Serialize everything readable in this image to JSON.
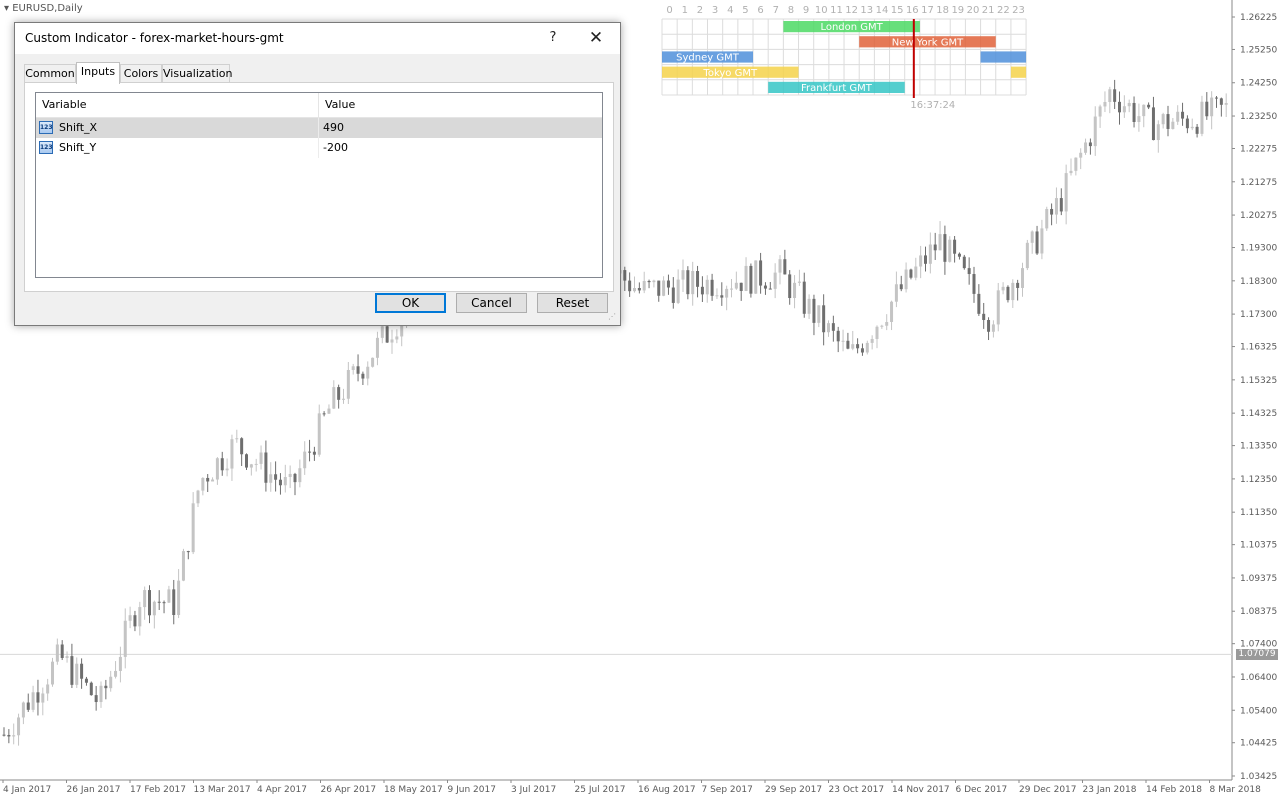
{
  "chart": {
    "symbol_title": "EURUSD,Daily",
    "current_price": "1.07079",
    "price_levels": [
      "1.26225",
      "1.25250",
      "1.24250",
      "1.23250",
      "1.22275",
      "1.21275",
      "1.20275",
      "1.19300",
      "1.18300",
      "1.17300",
      "1.16325",
      "1.15325",
      "1.14325",
      "1.13350",
      "1.12350",
      "1.11350",
      "1.10375",
      "1.09375",
      "1.08375",
      "1.07400",
      "1.06400",
      "1.05400",
      "1.04425",
      "1.03425"
    ],
    "date_labels": [
      "4 Jan 2017",
      "26 Jan 2017",
      "17 Feb 2017",
      "13 Mar 2017",
      "4 Apr 2017",
      "26 Apr 2017",
      "18 May 2017",
      "9 Jun 2017",
      "3 Jul 2017",
      "25 Jul 2017",
      "16 Aug 2017",
      "7 Sep 2017",
      "29 Sep 2017",
      "23 Oct 2017",
      "14 Nov 2017",
      "6 Dec 2017",
      "29 Dec 2017",
      "23 Jan 2018",
      "14 Feb 2018",
      "8 Mar 2018"
    ],
    "colors": {
      "bull": "#c4c4c4",
      "bear": "#6e6e6e",
      "text": "#5a5a5a",
      "grid_line": "#d8d8d8"
    }
  },
  "market_hours": {
    "hours": [
      "0",
      "1",
      "2",
      "3",
      "4",
      "5",
      "6",
      "7",
      "8",
      "9",
      "10",
      "11",
      "12",
      "13",
      "14",
      "15",
      "16",
      "17",
      "18",
      "19",
      "20",
      "21",
      "22",
      "23"
    ],
    "clock": "16:37:24",
    "sessions": [
      {
        "name": "London GMT",
        "start": 8,
        "end": 17,
        "extra_start": null,
        "extra_end": null,
        "color": "#4cd964"
      },
      {
        "name": "New York GMT",
        "start": 13,
        "end": 22,
        "extra_start": null,
        "extra_end": null,
        "color": "#e0613a"
      },
      {
        "name": "Sydney GMT",
        "start": 0,
        "end": 6,
        "extra_start": 21,
        "extra_end": 24,
        "color": "#4f8fdb"
      },
      {
        "name": "Tokyo GMT",
        "start": 0,
        "end": 9,
        "extra_start": 23,
        "extra_end": 24,
        "color": "#f5d24a"
      },
      {
        "name": "Frankfurt GMT",
        "start": 7,
        "end": 16,
        "extra_start": null,
        "extra_end": null,
        "color": "#35c6c6"
      }
    ],
    "current_hour": 16.6
  },
  "dialog": {
    "title": "Custom Indicator - forex-market-hours-gmt",
    "help_symbol": "?",
    "close_symbol": "✕",
    "tabs": [
      "Common",
      "Inputs",
      "Colors",
      "Visualization"
    ],
    "active_tab": "Inputs",
    "grid": {
      "headers": [
        "Variable",
        "Value"
      ],
      "rows": [
        {
          "icon": "123",
          "variable": "Shift_X",
          "value": "490"
        },
        {
          "icon": "123",
          "variable": "Shift_Y",
          "value": "-200"
        }
      ]
    },
    "buttons": {
      "ok": "OK",
      "cancel": "Cancel",
      "reset": "Reset"
    }
  }
}
